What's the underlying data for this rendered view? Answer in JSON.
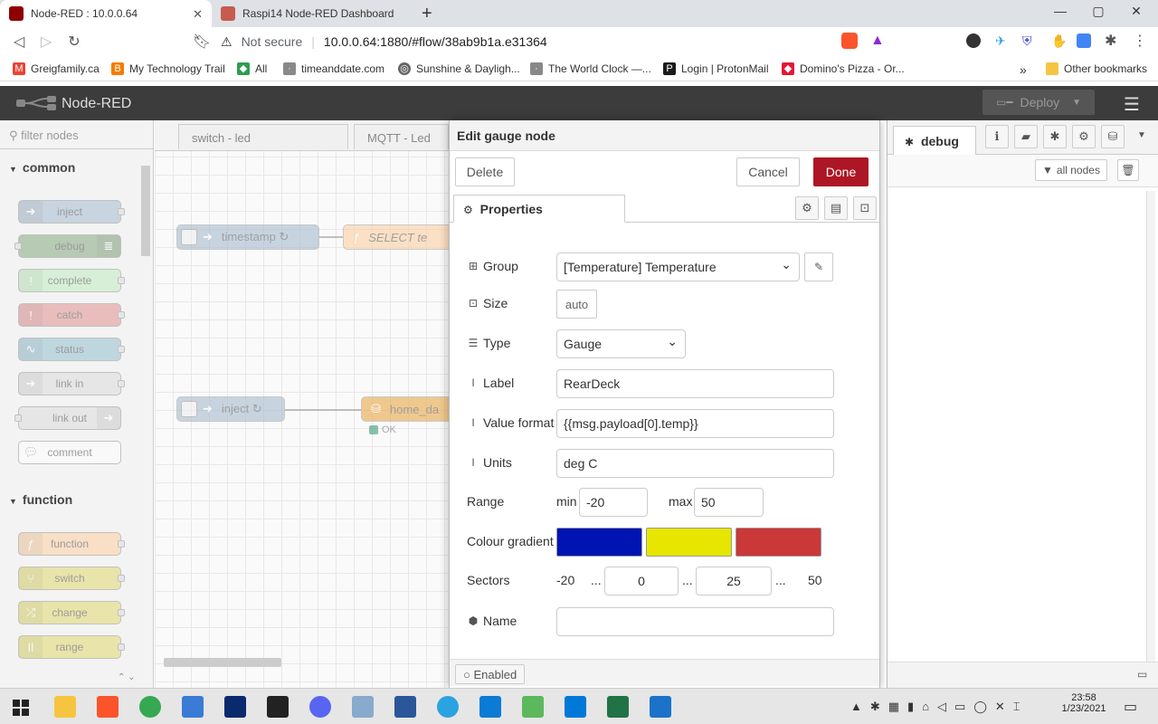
{
  "browser": {
    "tabs": [
      {
        "title": "Node-RED : 10.0.0.64",
        "active": true
      },
      {
        "title": "Raspi14 Node-RED Dashboard",
        "active": false
      }
    ],
    "new_tab": "+",
    "security": "Not secure",
    "url": "10.0.0.64:1880/#flow/38ab9b1a.e31364",
    "bookmarks": [
      "Greigfamily.ca",
      "My Technology Trail",
      "All",
      "timeanddate.com",
      "Sunshine & Dayligh...",
      "The World Clock —...",
      "Login | ProtonMail",
      "Domino's Pizza - Or..."
    ],
    "bookmarks_more": "»",
    "other_bookmarks": "Other bookmarks"
  },
  "app": {
    "title": "Node-RED",
    "deploy_label": "Deploy",
    "menu_icon": "hamburger-icon"
  },
  "palette": {
    "filter_placeholder": "filter nodes",
    "categories": [
      {
        "name": "common",
        "nodes": [
          "inject",
          "debug",
          "complete",
          "catch",
          "status",
          "link in",
          "link out",
          "comment"
        ]
      },
      {
        "name": "function",
        "nodes": [
          "function",
          "switch",
          "change",
          "range"
        ]
      }
    ],
    "colors": {
      "inject": "#a6bbcf",
      "debug": "#87a980",
      "complete": "#c0edc0",
      "catch": "#e49191",
      "status": "#94c1d0",
      "link": "#dddddd",
      "comment": "#ffffff",
      "function": "#fdd0a2",
      "switch": "#e2d96e",
      "change": "#e2d96e",
      "range": "#e2d96e"
    }
  },
  "workspace": {
    "tabs": [
      "switch - led",
      "MQTT - Led"
    ],
    "nodes": {
      "timestamp": "timestamp ↻",
      "select": "SELECT te",
      "inject": "inject ↻",
      "home": "home_da",
      "status_ok": "OK"
    }
  },
  "editor": {
    "title": "Edit gauge node",
    "delete_label": "Delete",
    "cancel_label": "Cancel",
    "done_label": "Done",
    "tab_properties": "Properties",
    "fields": {
      "group_label": "Group",
      "group_value": "[Temperature] Temperature",
      "size_label": "Size",
      "size_value": "auto",
      "type_label": "Type",
      "type_value": "Gauge",
      "label_label": "Label",
      "label_value": "RearDeck",
      "format_label": "Value format",
      "format_value": "{{msg.payload[0].temp}}",
      "units_label": "Units",
      "units_value": "deg C",
      "range_label": "Range",
      "min_label": "min",
      "min_value": "-20",
      "max_label": "max",
      "max_value": "50",
      "gradient_label": "Colour gradient",
      "gradient_colors": [
        "#0014b4",
        "#e6e600",
        "#ca3838"
      ],
      "sectors_label": "Sectors",
      "sector_start": "-20",
      "sector_1": "0",
      "sector_2": "25",
      "sector_end": "50",
      "ellipsis": "...",
      "name_label": "Name",
      "name_value": ""
    },
    "enabled_label": "Enabled"
  },
  "sidebar": {
    "tab_debug": "debug",
    "filter_label": "all nodes"
  },
  "taskbar": {
    "time": "23:58",
    "date": "1/23/2021"
  }
}
